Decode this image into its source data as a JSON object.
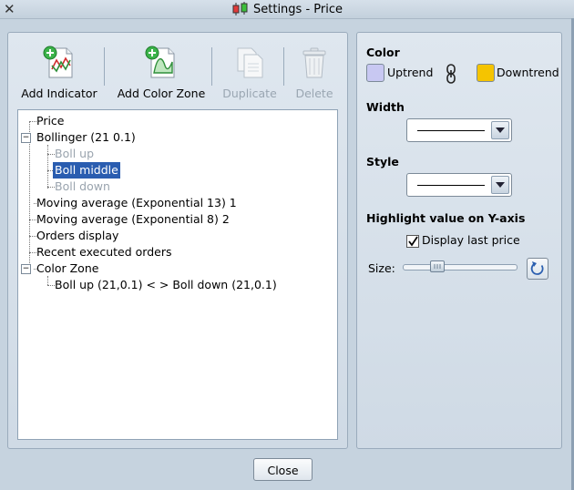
{
  "window": {
    "title": "Settings - Price",
    "close_glyph": "✕"
  },
  "toolbar": {
    "add_indicator": "Add Indicator",
    "add_color_zone": "Add Color Zone",
    "duplicate": "Duplicate",
    "delete": "Delete"
  },
  "tree": {
    "price": "Price",
    "bollinger": "Bollinger (21 0.1)",
    "boll_up": "Boll up",
    "boll_middle": "Boll middle",
    "boll_down": "Boll down",
    "ma13": "Moving average (Exponential 13) 1",
    "ma8": "Moving average (Exponential 8) 2",
    "orders_display": "Orders display",
    "recent_orders": "Recent executed orders",
    "color_zone": "Color Zone",
    "zone_item": "Boll up (21,0.1) < > Boll down (21,0.1)",
    "collapse_glyph": "−",
    "selected_item": "Boll middle"
  },
  "right": {
    "color_title": "Color",
    "uptrend": "Uptrend",
    "downtrend": "Downtrend",
    "uptrend_color": "#c8c8f2",
    "downtrend_color": "#f5c400",
    "width_title": "Width",
    "style_title": "Style",
    "highlight_title": "Highlight value on Y-axis",
    "display_last_price": "Display last price",
    "display_last_price_checked": true,
    "size_label": "Size:"
  },
  "footer": {
    "close": "Close"
  },
  "icons": {
    "window": "candlestick-icon",
    "add_indicator": "add-indicator-icon",
    "add_color_zone": "add-color-zone-icon",
    "duplicate": "duplicate-icon",
    "delete": "trash-icon",
    "link": "chain-link-icon",
    "reset": "reset-icon"
  }
}
